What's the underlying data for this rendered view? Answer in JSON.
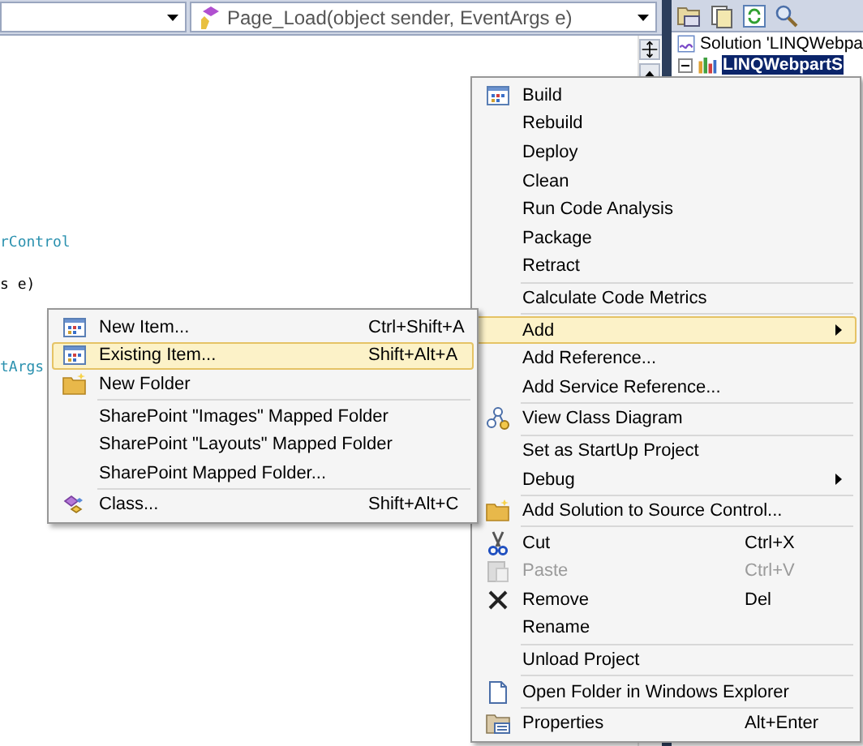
{
  "editor": {
    "member_dropdown": {
      "value": "Page_Load(object sender, EventArgs e)"
    },
    "code_lines": [
      {
        "text": "rControl",
        "kind": "type"
      },
      {
        "text": "s e)",
        "kind": "plain"
      },
      {
        "text": "tArgs",
        "kind": "type"
      }
    ]
  },
  "solution_explorer": {
    "tree": [
      {
        "label": "Solution 'LINQWebpa",
        "selected": false,
        "children": [
          {
            "label": "LINQWebpartS",
            "selected": true,
            "expanded": true
          }
        ]
      }
    ]
  },
  "context_menu": {
    "groups": [
      [
        {
          "label": "Build",
          "selected": false,
          "disabled": false
        },
        {
          "label": "Rebuild",
          "selected": false,
          "disabled": false
        },
        {
          "label": "Deploy",
          "selected": false,
          "disabled": false
        },
        {
          "label": "Clean",
          "selected": false,
          "disabled": false
        },
        {
          "label": "Run Code Analysis",
          "selected": false,
          "disabled": false
        },
        {
          "label": "Package",
          "selected": false,
          "disabled": false
        },
        {
          "label": "Retract",
          "selected": false,
          "disabled": false
        }
      ],
      [
        {
          "label": "Calculate Code Metrics",
          "selected": false,
          "disabled": false
        }
      ],
      [
        {
          "label": "Add",
          "selected": true,
          "disabled": false,
          "submenu": true
        },
        {
          "label": "Add Reference...",
          "selected": false,
          "disabled": false
        },
        {
          "label": "Add Service Reference...",
          "selected": false,
          "disabled": false
        }
      ],
      [
        {
          "label": "View Class Diagram",
          "selected": false,
          "disabled": false
        }
      ],
      [
        {
          "label": "Set as StartUp Project",
          "selected": false,
          "disabled": false
        },
        {
          "label": "Debug",
          "selected": false,
          "disabled": false,
          "submenu": true
        }
      ],
      [
        {
          "label": "Add Solution to Source Control...",
          "selected": false,
          "disabled": false
        }
      ],
      [
        {
          "label": "Cut",
          "shortcut": "Ctrl+X",
          "selected": false,
          "disabled": false
        },
        {
          "label": "Paste",
          "shortcut": "Ctrl+V",
          "selected": false,
          "disabled": true
        },
        {
          "label": "Remove",
          "shortcut": "Del",
          "selected": false,
          "disabled": false
        },
        {
          "label": "Rename",
          "selected": false,
          "disabled": false
        }
      ],
      [
        {
          "label": "Unload Project",
          "selected": false,
          "disabled": false
        }
      ],
      [
        {
          "label": "Open Folder in Windows Explorer",
          "selected": false,
          "disabled": false
        }
      ],
      [
        {
          "label": "Properties",
          "shortcut": "Alt+Enter",
          "selected": false,
          "disabled": false
        }
      ]
    ]
  },
  "add_submenu": {
    "groups": [
      [
        {
          "label": "New Item...",
          "shortcut": "Ctrl+Shift+A",
          "selected": false
        },
        {
          "label": "Existing Item...",
          "shortcut": "Shift+Alt+A",
          "selected": true
        },
        {
          "label": "New Folder",
          "selected": false
        }
      ],
      [
        {
          "label": "SharePoint \"Images\" Mapped Folder",
          "selected": false
        },
        {
          "label": "SharePoint \"Layouts\" Mapped Folder",
          "selected": false
        },
        {
          "label": "SharePoint Mapped Folder...",
          "selected": false
        }
      ],
      [
        {
          "label": "Class...",
          "shortcut": "Shift+Alt+C",
          "selected": false
        }
      ]
    ]
  }
}
